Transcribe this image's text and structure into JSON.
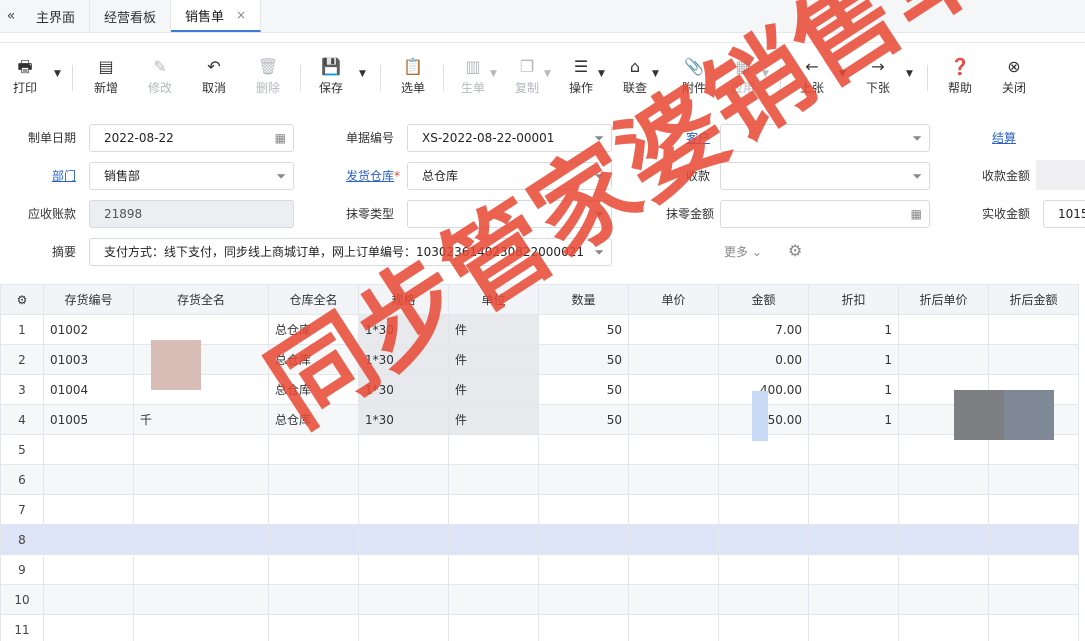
{
  "tabs": {
    "collapse_icon": "chevron-double-left-icon",
    "items": [
      {
        "label": "主界面",
        "active": false
      },
      {
        "label": "经营看板",
        "active": false
      },
      {
        "label": "销售单",
        "active": true
      }
    ],
    "close_glyph": "×"
  },
  "toolbar": {
    "print": "打印",
    "add": "新增",
    "edit": "修改",
    "cancel": "取消",
    "delete": "删除",
    "save": "保存",
    "select_doc": "选单",
    "generate": "生单",
    "copy": "复制",
    "operate": "操作",
    "linked_query": "联查",
    "attachment": "附件",
    "apply": "应用",
    "prev": "上张",
    "next": "下张",
    "help": "帮助",
    "close": "关闭"
  },
  "form": {
    "order_date": {
      "label": "制单日期",
      "value": "2022-08-22"
    },
    "doc_no": {
      "label": "单据编号",
      "value": "XS-2022-08-22-00001"
    },
    "customer": {
      "label": "客户",
      "value": ""
    },
    "settle": {
      "label": "结算",
      "value": ""
    },
    "dept": {
      "label": "部门",
      "value": "销售部"
    },
    "warehouse": {
      "label": "发货仓库",
      "value": "总仓库",
      "required": "*"
    },
    "receive_account": {
      "label": "收款",
      "value": ""
    },
    "receive_amount": {
      "label": "收款金额",
      "value": ""
    },
    "receivable": {
      "label": "应收账款",
      "value": "21898"
    },
    "rounding_type": {
      "label": "抹零类型",
      "value": ""
    },
    "rounding_amount": {
      "label": "抹零金额",
      "value": ""
    },
    "actual_amount": {
      "label": "实收金额",
      "value": "1015"
    },
    "summary": {
      "label": "摘要",
      "value": "支付方式：线下支付，同步线上商城订单，网上订单编号：1030236140230822000021"
    },
    "more": "更多"
  },
  "grid": {
    "columns": [
      "存货编号",
      "存货全名",
      "仓库全名",
      "规格",
      "单位",
      "数量",
      "单价",
      "金额",
      "折扣",
      "折后单价",
      "折后金额"
    ],
    "rows": [
      {
        "idx": "1",
        "code": "01002",
        "name": "",
        "warehouse": "总仓库",
        "spec": "1*30",
        "unit": "件",
        "qty": "50",
        "price": "",
        "amount": "7.00",
        "discount": "1",
        "dprice": "",
        "damount": ""
      },
      {
        "idx": "2",
        "code": "01003",
        "name": "",
        "warehouse": "总仓库",
        "spec": "1*30",
        "unit": "件",
        "qty": "50",
        "price": "",
        "amount": "0.00",
        "discount": "1",
        "dprice": "",
        "damount": ""
      },
      {
        "idx": "3",
        "code": "01004",
        "name": "",
        "warehouse": "总仓库",
        "spec": "1*30",
        "unit": "件",
        "qty": "50",
        "price": "",
        "amount": "400.00",
        "discount": "1",
        "dprice": "",
        "damount": ""
      },
      {
        "idx": "4",
        "code": "01005",
        "name": "千",
        "warehouse": "总仓库",
        "spec": "1*30",
        "unit": "件",
        "qty": "50",
        "price": "",
        "amount": "250.00",
        "discount": "1",
        "dprice": "",
        "damount": ""
      },
      {
        "idx": "5"
      },
      {
        "idx": "6"
      },
      {
        "idx": "7"
      },
      {
        "idx": "8"
      },
      {
        "idx": "9"
      },
      {
        "idx": "10"
      },
      {
        "idx": "11"
      }
    ]
  },
  "watermark": "同步管家婆销售单",
  "colors": {
    "watermark": "#e84834",
    "link": "#2b62c7",
    "active_tab_line": "#3b7ddd",
    "selected_row": "#dde4f7"
  }
}
